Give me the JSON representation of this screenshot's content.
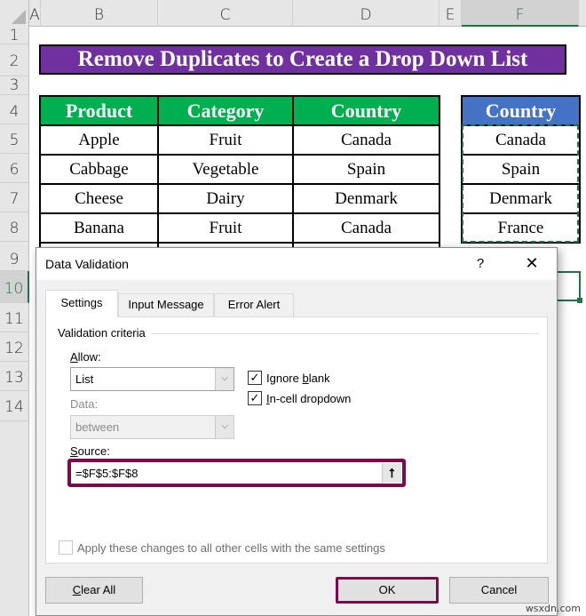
{
  "sheet": {
    "columns": [
      "A",
      "B",
      "C",
      "D",
      "E",
      "F"
    ],
    "selected_column": "F",
    "rows": [
      "1",
      "2",
      "3",
      "4",
      "5",
      "6",
      "7",
      "8",
      "9",
      "10",
      "11",
      "12",
      "13",
      "14"
    ],
    "selected_row": "10",
    "title": "Remove Duplicates to Create a Drop Down List",
    "main_table": {
      "headers": [
        "Product",
        "Category",
        "Country"
      ],
      "rows": [
        [
          "Apple",
          "Fruit",
          "Canada"
        ],
        [
          "Cabbage",
          "Vegetable",
          "Spain"
        ],
        [
          "Cheese",
          "Dairy",
          "Denmark"
        ],
        [
          "Banana",
          "Fruit",
          "Canada"
        ]
      ]
    },
    "unique_table": {
      "header": "Country",
      "values": [
        "Canada",
        "Spain",
        "Denmark",
        "France"
      ]
    },
    "colors": {
      "title_bg": "#7030a0",
      "main_header_bg": "#00b050",
      "unique_header_bg": "#4472c4",
      "selection": "#217346",
      "highlight": "#7b0c4c"
    }
  },
  "dialog": {
    "title": "Data Validation",
    "help_label": "?",
    "close_label": "✕",
    "tabs": [
      {
        "label": "Settings",
        "active": true
      },
      {
        "label": "Input Message",
        "active": false
      },
      {
        "label": "Error Alert",
        "active": false
      }
    ],
    "group_label": "Validation criteria",
    "allow": {
      "label_prefix": "",
      "label_ul": "A",
      "label_rest": "llow:",
      "value": "List"
    },
    "data": {
      "label": "Data:",
      "value": "between",
      "disabled": true
    },
    "ignore_blank": {
      "label_pre": "Ignore ",
      "label_ul": "b",
      "label_post": "lank",
      "checked": true
    },
    "in_cell_dropdown": {
      "label_pre": "",
      "label_ul": "I",
      "label_post": "n-cell dropdown",
      "checked": true
    },
    "source": {
      "label_ul": "S",
      "label_rest": "ource:",
      "value": "=$F$5:$F$8",
      "collapse_icon": "⭡"
    },
    "apply_all": {
      "label": "Apply these changes to all other cells with the same settings",
      "checked": false,
      "disabled": true
    },
    "buttons": {
      "clear_all_ul": "C",
      "clear_all_rest": "lear All",
      "ok": "OK",
      "cancel": "Cancel"
    },
    "check_glyph": "✓",
    "dropdown_glyph": "⌵"
  },
  "watermark": "wsxdn.com"
}
